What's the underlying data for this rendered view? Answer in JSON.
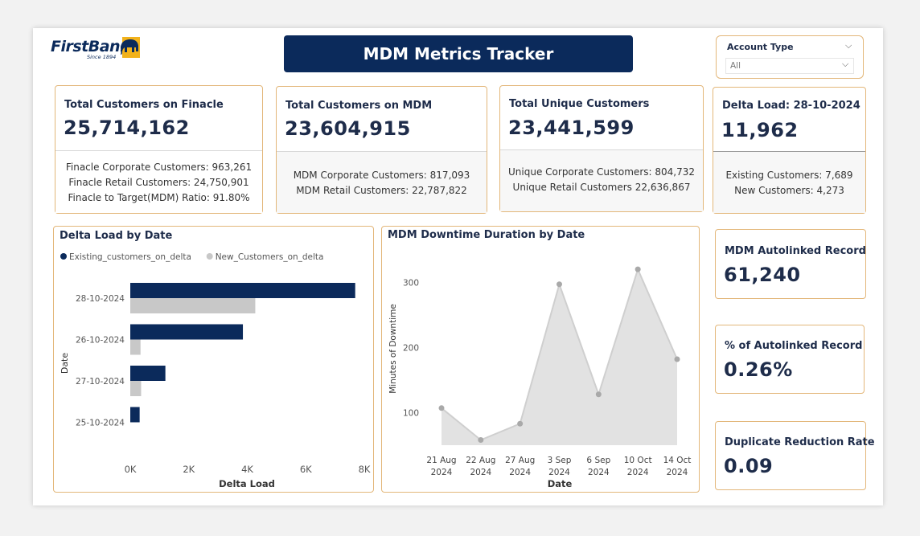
{
  "header": {
    "logo_text": "FirstBank",
    "logo_since": "Since 1894",
    "title": "MDM Metrics Tracker"
  },
  "slicer": {
    "label": "Account Type",
    "value": "All"
  },
  "kpis": {
    "finacle": {
      "title": "Total Customers on Finacle",
      "value": "25,714,162",
      "lines": [
        "Finacle Corporate Customers:  963,261",
        "Finacle Retail Customers:  24,750,901",
        "Finacle to Target(MDM) Ratio:  91.80%"
      ]
    },
    "mdm": {
      "title": "Total Customers on MDM",
      "value": "23,604,915",
      "lines": [
        "MDM Corporate Customers:  817,093",
        "MDM Retail Customers:  22,787,822"
      ]
    },
    "unique": {
      "title": "Total Unique Customers",
      "value": "23,441,599",
      "lines": [
        "Unique Corporate Customers:  804,732",
        "Unique Retail Customers 22,636,867"
      ]
    },
    "delta": {
      "title": "Delta Load: 28-10-2024",
      "value": "11,962",
      "lines": [
        "Existing Customers:  7,689",
        "New Customers:  4,273"
      ]
    },
    "autolinked": {
      "title": "MDM Autolinked Record",
      "value": "61,240"
    },
    "pct_autolinked": {
      "title": "% of Autolinked Record",
      "value": "0.26%"
    },
    "duplicate": {
      "title": "Duplicate Reduction Rate",
      "value": "0.09"
    }
  },
  "chart_data": [
    {
      "type": "bar",
      "orientation": "horizontal",
      "title": "Delta Load by Date",
      "xlabel": "Delta Load",
      "ylabel": "Date",
      "categories": [
        "28-10-2024",
        "26-10-2024",
        "27-10-2024",
        "25-10-2024"
      ],
      "series": [
        {
          "name": "Existing_customers_on_delta",
          "color": "#0b2a5b",
          "values": [
            7689,
            3850,
            1200,
            320
          ]
        },
        {
          "name": "New_Customers_on_delta",
          "color": "#c8c8c8",
          "values": [
            4273,
            350,
            370,
            0
          ]
        }
      ],
      "xlim": [
        0,
        8000
      ],
      "xticks": [
        "0K",
        "2K",
        "4K",
        "6K",
        "8K"
      ],
      "legend": "top-left"
    },
    {
      "type": "area",
      "title": "MDM Downtime Duration by Date",
      "xlabel": "Date",
      "ylabel": "Minutes of Downtime",
      "x": [
        "21 Aug 2024",
        "22 Aug 2024",
        "27 Aug 2024",
        "3 Sep 2024",
        "6 Sep 2024",
        "10 Oct 2024",
        "14 Oct 2024"
      ],
      "values": [
        107,
        58,
        83,
        297,
        128,
        320,
        182
      ],
      "ylim": [
        50,
        330
      ],
      "yticks": [
        100,
        200,
        300
      ],
      "color": "#e2e2e2",
      "line_color": "#cfcfcf"
    }
  ]
}
